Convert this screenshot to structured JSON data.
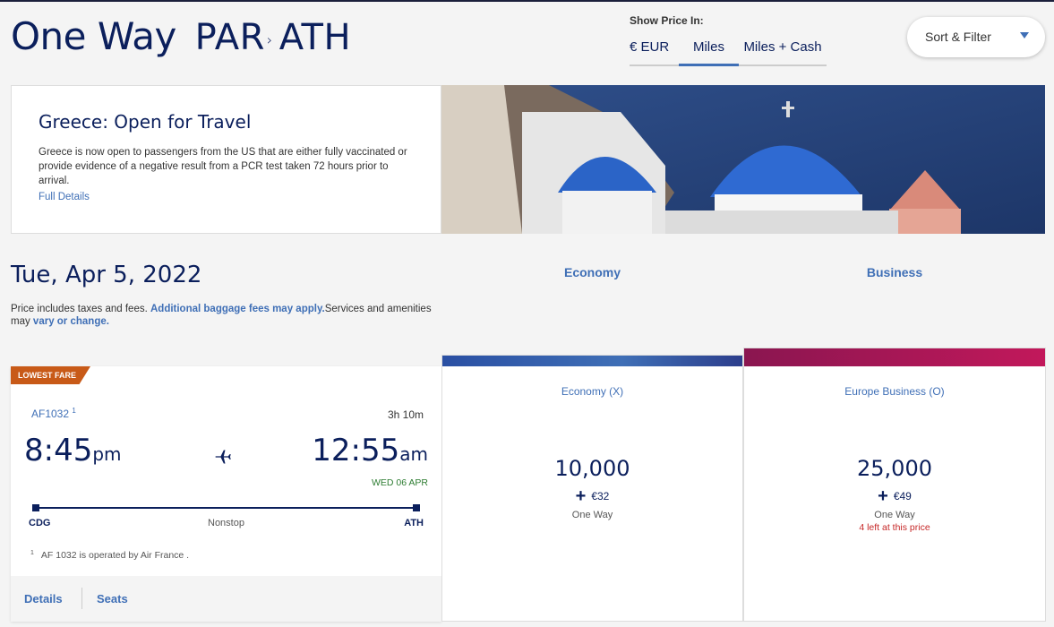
{
  "header": {
    "title": "One Way",
    "origin": "PAR",
    "destination": "ATH"
  },
  "price_toggle": {
    "label": "Show Price In:",
    "options": [
      "€ EUR",
      "Miles",
      "Miles + Cash"
    ],
    "selected": "Miles"
  },
  "sort_filter": {
    "label": "Sort & Filter"
  },
  "promo": {
    "title": "Greece: Open for Travel",
    "body": "Greece is now open to passengers from the US that are either fully vaccinated or provide evidence of a negative result from a PCR test taken 72 hours prior to arrival.",
    "link": "Full Details"
  },
  "results": {
    "date": "Tue, Apr 5, 2022",
    "disclaimer_pre": "Price includes taxes and fees. ",
    "disclaimer_link1": "Additional baggage fees may apply.",
    "disclaimer_mid": "Services and amenities may ",
    "disclaimer_link2": "vary or change."
  },
  "columns": [
    "Economy",
    "Business"
  ],
  "flight": {
    "badge": "LOWEST FARE",
    "number": "AF1032",
    "footnote_mark": "1",
    "duration": "3h 10m",
    "dep_time": "8:45",
    "dep_ampm": "pm",
    "arr_time": "12:55",
    "arr_ampm": "am",
    "arr_date": "WED 06 APR",
    "from": "CDG",
    "to": "ATH",
    "stops": "Nonstop",
    "footnote": "AF 1032 is operated by Air France .",
    "tabs": [
      "Details",
      "Seats"
    ]
  },
  "fares": [
    {
      "name": "Economy (X)",
      "miles": "10,000",
      "cash": "€32",
      "trip": "One Way",
      "note": ""
    },
    {
      "name": "Europe Business (O)",
      "miles": "25,000",
      "cash": "€49",
      "trip": "One Way",
      "note": "4 left at this price"
    }
  ],
  "colors": {
    "navy": "#0b1f5c",
    "accent_blue": "#3f6fb6",
    "badge_orange": "#c85a18",
    "business_magenta": "#c2185b",
    "arrival_green": "#2e7d32",
    "alert_red": "#c62828"
  }
}
